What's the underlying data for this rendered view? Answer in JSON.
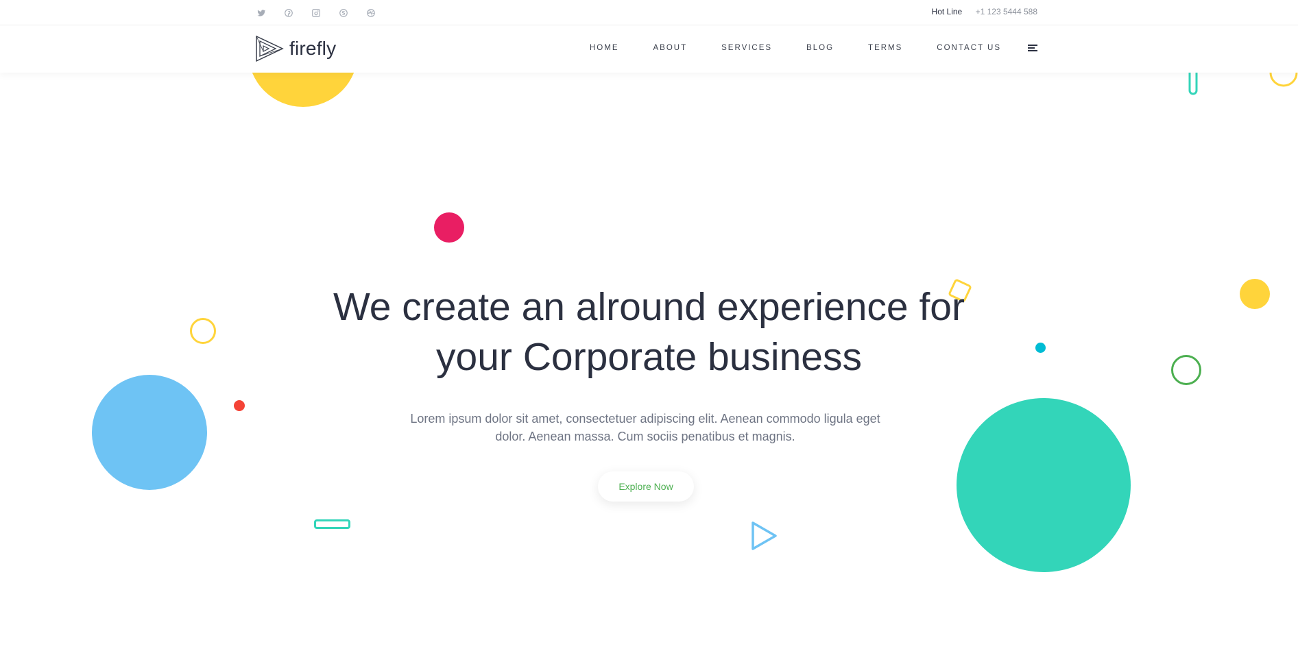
{
  "topbar": {
    "social_icons": [
      "twitter-icon",
      "pinterest-icon",
      "instagram-icon",
      "skype-icon",
      "dribbble-icon"
    ],
    "hotline_label": "Hot Line",
    "hotline_number": "+1 123 5444 588"
  },
  "header": {
    "brand": "firefly",
    "nav": [
      "HOME",
      "ABOUT",
      "SERVICES",
      "BLOG",
      "TERMS",
      "CONTACT US"
    ],
    "menu_icon": "hamburger-menu-icon"
  },
  "hero": {
    "title_line1": "We create an alround experience for",
    "title_line2": "your Corporate business",
    "subtitle_line1": "Lorem ipsum dolor sit amet, consectetuer adipiscing elit. Aenean commodo ligula eget",
    "subtitle_line2": "dolor. Aenean massa. Cum sociis penatibus et magnis.",
    "cta": "Explore Now"
  },
  "colors": {
    "yellow": "#ffd43b",
    "pink": "#e91e63",
    "blue": "#6ec3f4",
    "teal": "#33d5b9",
    "green": "#4caf50",
    "red": "#f44336",
    "cyan": "#00bcd4",
    "text_dark": "#2b3040",
    "text_muted": "#6f7584"
  }
}
